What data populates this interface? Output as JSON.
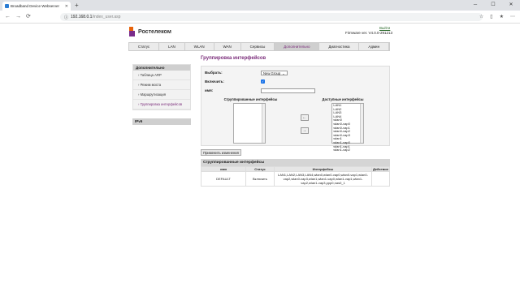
{
  "browser": {
    "tab_title": "Broadband Device Webserver",
    "new_tab": "+",
    "url_host": "192.168.0.1",
    "url_path": "/index_user.asp"
  },
  "header": {
    "brand": "Ростелеком",
    "logout": "Выйти",
    "firmware": "Firmware ver. V4.0.0-291213"
  },
  "menu": [
    "Статус",
    "LAN",
    "WLAN",
    "WAN",
    "Сервисы",
    "Дополнительно",
    "Диагностика",
    "Админ"
  ],
  "sidebar": {
    "title": "Дополнительно",
    "items": [
      "Таблица ARP",
      "Режим моста",
      "Маршрутизация",
      "Группировка интерфейсов"
    ],
    "ipv6": "IPv6"
  },
  "form": {
    "title": "Группировка интерфейсов",
    "select_label": "Выбрать:",
    "select_value": "New Group",
    "enable_label": "Включить:",
    "name_label": "имя:",
    "grouped_header": "Сгруппированные интерфейсы",
    "available_header": "Доступные интерфейсы",
    "available": [
      "LAN1",
      "LAN2",
      "LAN3",
      "LAN4",
      "wlan0",
      "wlan0-vap0",
      "wlan0-vap1",
      "wlan0-vap2",
      "wlan0-vap3",
      "wlan1",
      "wlan1-vap0",
      "wlan1-vap1",
      "wlan1-vap2"
    ],
    "apply": "Применить изменения"
  },
  "groups": {
    "title": "Сгруппированные интерфейсы",
    "columns": [
      "имя",
      "Статус",
      "Интерфейсы",
      "Действие"
    ],
    "row": {
      "name": "DEFAULT",
      "status": "Включить",
      "interfaces": "LAN1,LAN2,LAN3,LAN4,wlan0,wlan0-vap0,wlan0-vap1,wlan0-vap2,wlan0-vap3,wlan1,wlan1-vap0,wlan1-vap1,wlan1-vap2,wlan1-vap3,ppp0,nas0_1",
      "action": ""
    }
  }
}
